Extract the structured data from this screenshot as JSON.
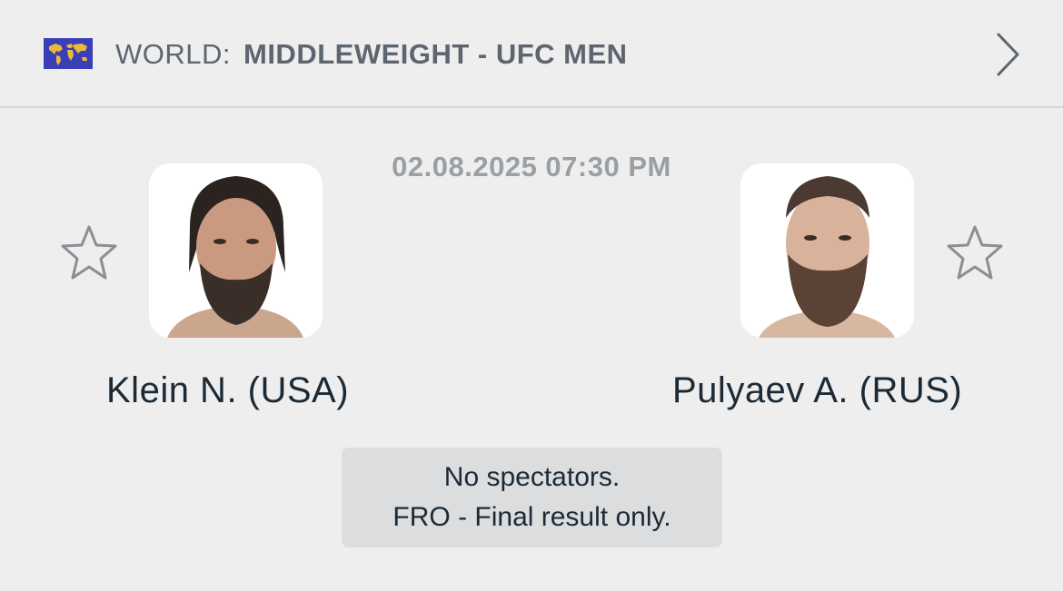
{
  "header": {
    "flag_icon": "world-map-flag-icon",
    "country": "WORLD:",
    "competition": "MIDDLEWEIGHT - UFC MEN",
    "nav_icon": "chevron-right-icon"
  },
  "match": {
    "datetime": "02.08.2025 07:30 PM",
    "home": {
      "name": "Klein N. (USA)",
      "favorite_icon": "star-outline-icon",
      "photo": "fighter-photo"
    },
    "away": {
      "name": "Pulyaev A. (RUS)",
      "favorite_icon": "star-outline-icon",
      "photo": "fighter-photo"
    },
    "info_lines": [
      "No spectators.",
      "FRO - Final result only."
    ]
  },
  "colors": {
    "background": "#eeeeee",
    "text_primary": "#1b2a36",
    "text_secondary": "#5d6670",
    "datetime": "#9a9fa4",
    "info_box": "#dcdddf",
    "flag_blue": "#3a3fb7",
    "flag_land": "#e8b93a"
  }
}
